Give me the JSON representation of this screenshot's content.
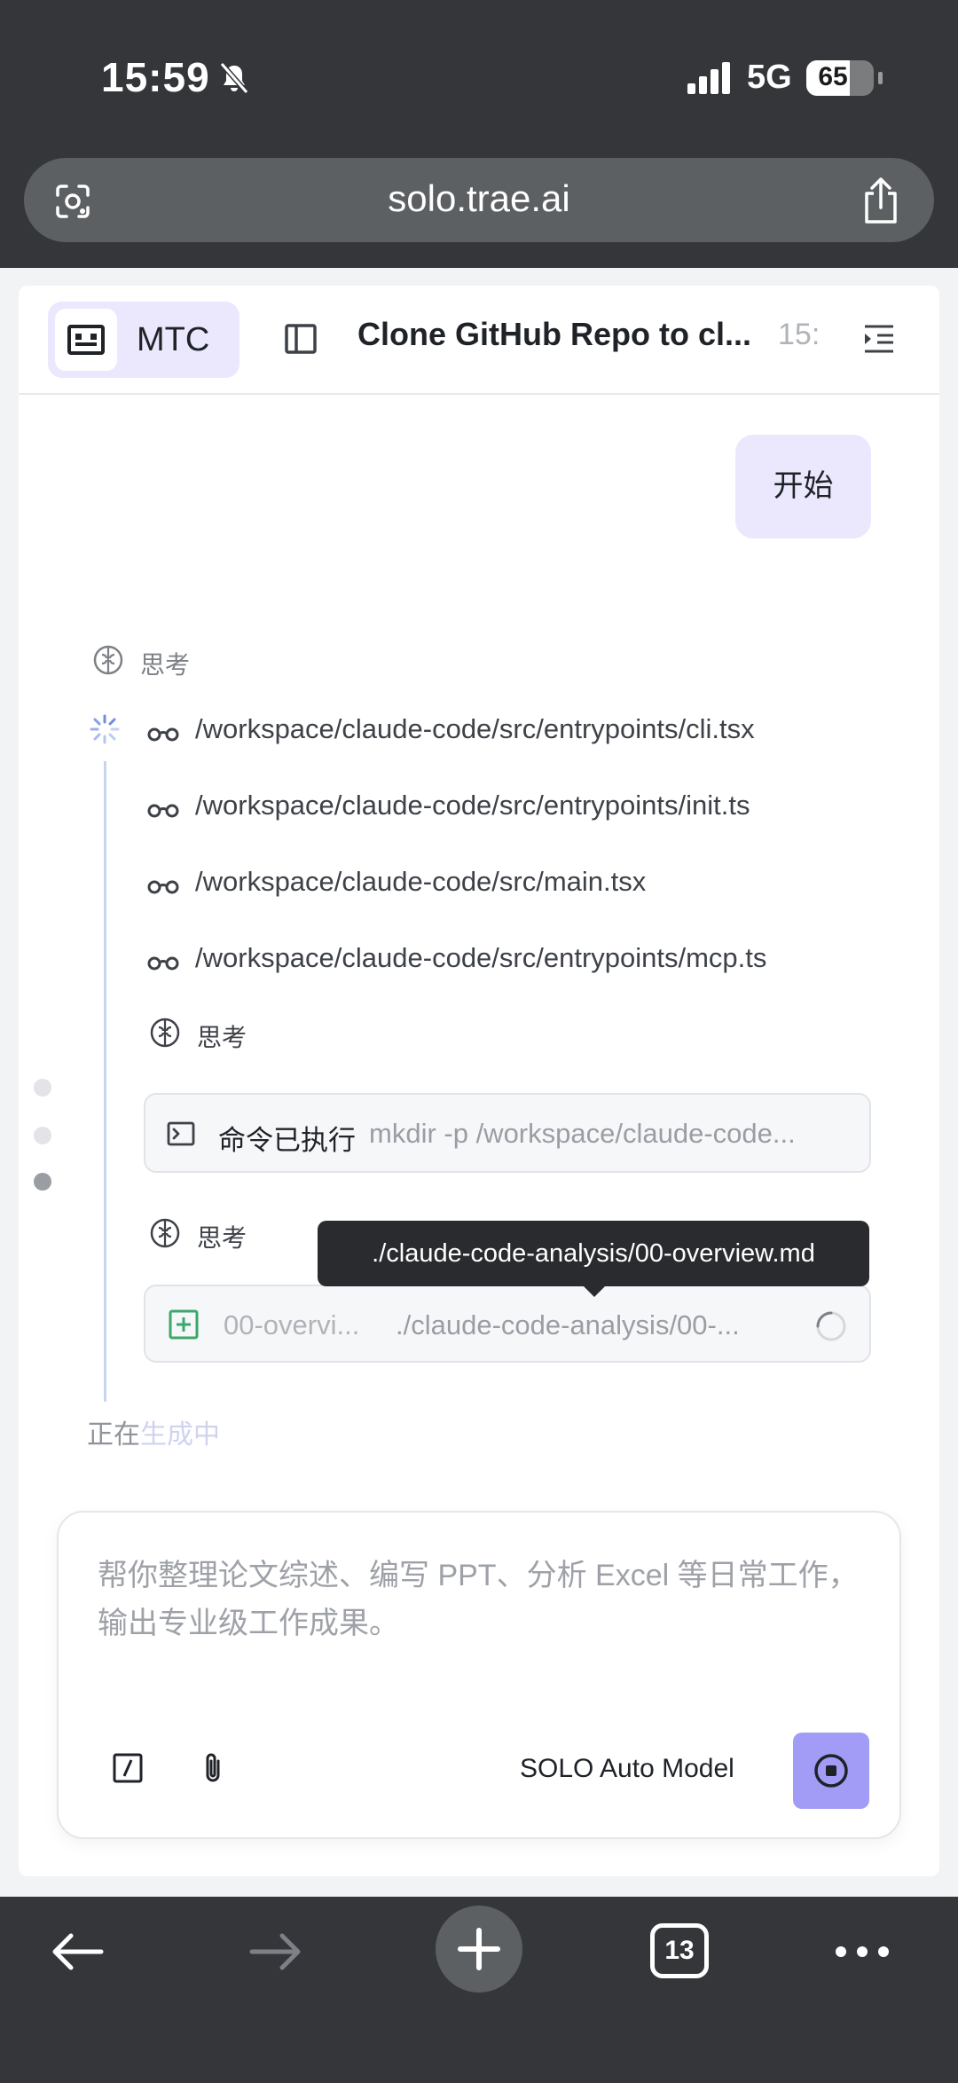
{
  "status_bar": {
    "time": "15:59",
    "network": "5G",
    "battery": "65",
    "battery_level": 0.65
  },
  "browser": {
    "url": "solo.trae.ai",
    "tab_count": "13"
  },
  "header": {
    "workspace_label": "MTC",
    "title": "Clone GitHub Repo to cl...",
    "time": "15:"
  },
  "chat": {
    "user_message": "开始",
    "think_label_top": "思考",
    "file_reads": [
      "/workspace/claude-code/src/entrypoints/cli.tsx",
      "/workspace/claude-code/src/entrypoints/init.ts",
      "/workspace/claude-code/src/main.tsx",
      "/workspace/claude-code/src/entrypoints/mcp.ts"
    ],
    "think_label_1": "思考",
    "command": {
      "label": "命令已执行",
      "text": "mkdir -p /workspace/claude-code..."
    },
    "think_label_2": "思考",
    "tooltip": "./claude-code-analysis/00-overview.md",
    "file_create": {
      "name": "00-overvi...",
      "path": "./claude-code-analysis/00-..."
    },
    "generating_prefix": "正在",
    "generating_suffix": "生成中"
  },
  "composer": {
    "placeholder": "帮你整理论文综述、编写 PPT、分析 Excel 等日常工作，输出专业级工作成果。",
    "model": "SOLO Auto Model"
  },
  "icons": {
    "bell": "bell-slash-icon",
    "signal": "signal-bars-icon",
    "lens": "google-lens-icon",
    "share": "share-icon",
    "glasses": "glasses-icon",
    "terminal": "terminal-icon",
    "brain": "brain-icon",
    "file_add": "file-plus-icon",
    "stop": "stop-icon"
  },
  "colors": {
    "accent": "#a39cf7",
    "pill_bg": "#ebe8fe",
    "file_add_green": "#3aa76d"
  }
}
